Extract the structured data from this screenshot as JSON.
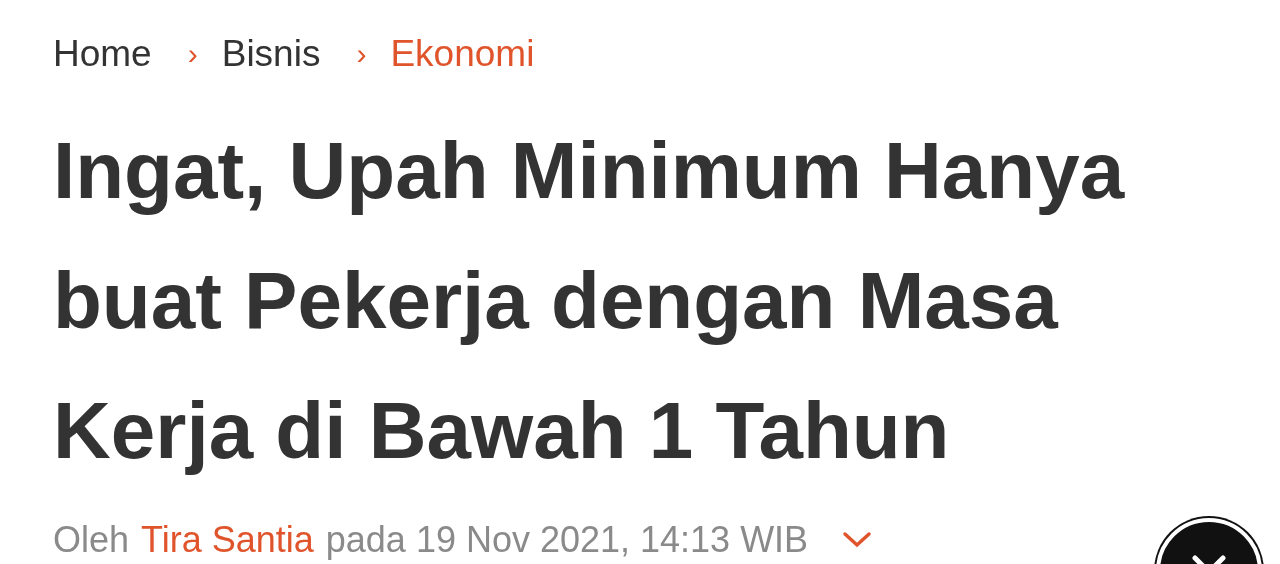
{
  "breadcrumb": [
    {
      "label": "Home",
      "current": false
    },
    {
      "label": "Bisnis",
      "separator": "›",
      "current": false
    },
    {
      "label": "Ekonomi",
      "separator": "›",
      "current": true
    }
  ],
  "title": "Ingat, Upah Minimum Hanya buat Pekerja dengan Masa Kerja di Bawah 1 Tahun",
  "byline": {
    "prefix": "Oleh",
    "author": "Tira Santia",
    "suffix": "pada 19 Nov 2021, 14:13 WIB"
  }
}
